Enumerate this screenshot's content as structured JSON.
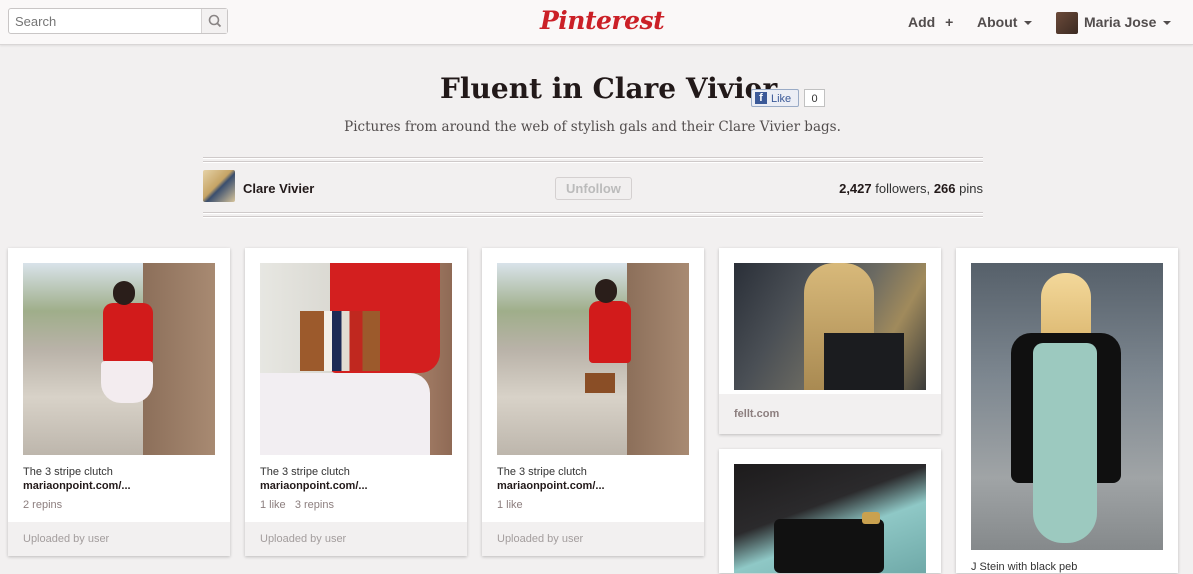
{
  "header": {
    "search_placeholder": "Search",
    "logo": "Pinterest",
    "add_label": "Add",
    "about_label": "About",
    "user_name": "Maria Jose"
  },
  "board": {
    "title": "Fluent in Clare Vivier",
    "fb_like_label": "Like",
    "fb_like_count": "0",
    "description": "Pictures from around the web of stylish gals and their Clare Vivier bags.",
    "owner": "Clare Vivier",
    "unfollow_label": "Unfollow",
    "followers": "2,427",
    "followers_label": "followers,",
    "pins": "266",
    "pins_label": "pins"
  },
  "pins": [
    {
      "title": "The 3 stripe clutch",
      "source": "mariaonpoint.com/...",
      "stats": "2 repins",
      "footer": "Uploaded by user"
    },
    {
      "title": "The 3 stripe clutch",
      "source": "mariaonpoint.com/...",
      "stats": "1 like   3 repins",
      "footer": "Uploaded by user"
    },
    {
      "title": "The 3 stripe clutch",
      "source": "mariaonpoint.com/...",
      "stats": "1 like",
      "footer": "Uploaded by user"
    },
    {
      "footer": "fellt.com"
    },
    {},
    {
      "title": "J Stein with black peb"
    }
  ],
  "colors": {
    "brand": "#cb2027",
    "page_bg": "#f2f0f0"
  },
  "icons": [
    "search-icon",
    "plus-icon",
    "caret-down-icon",
    "facebook-icon"
  ]
}
